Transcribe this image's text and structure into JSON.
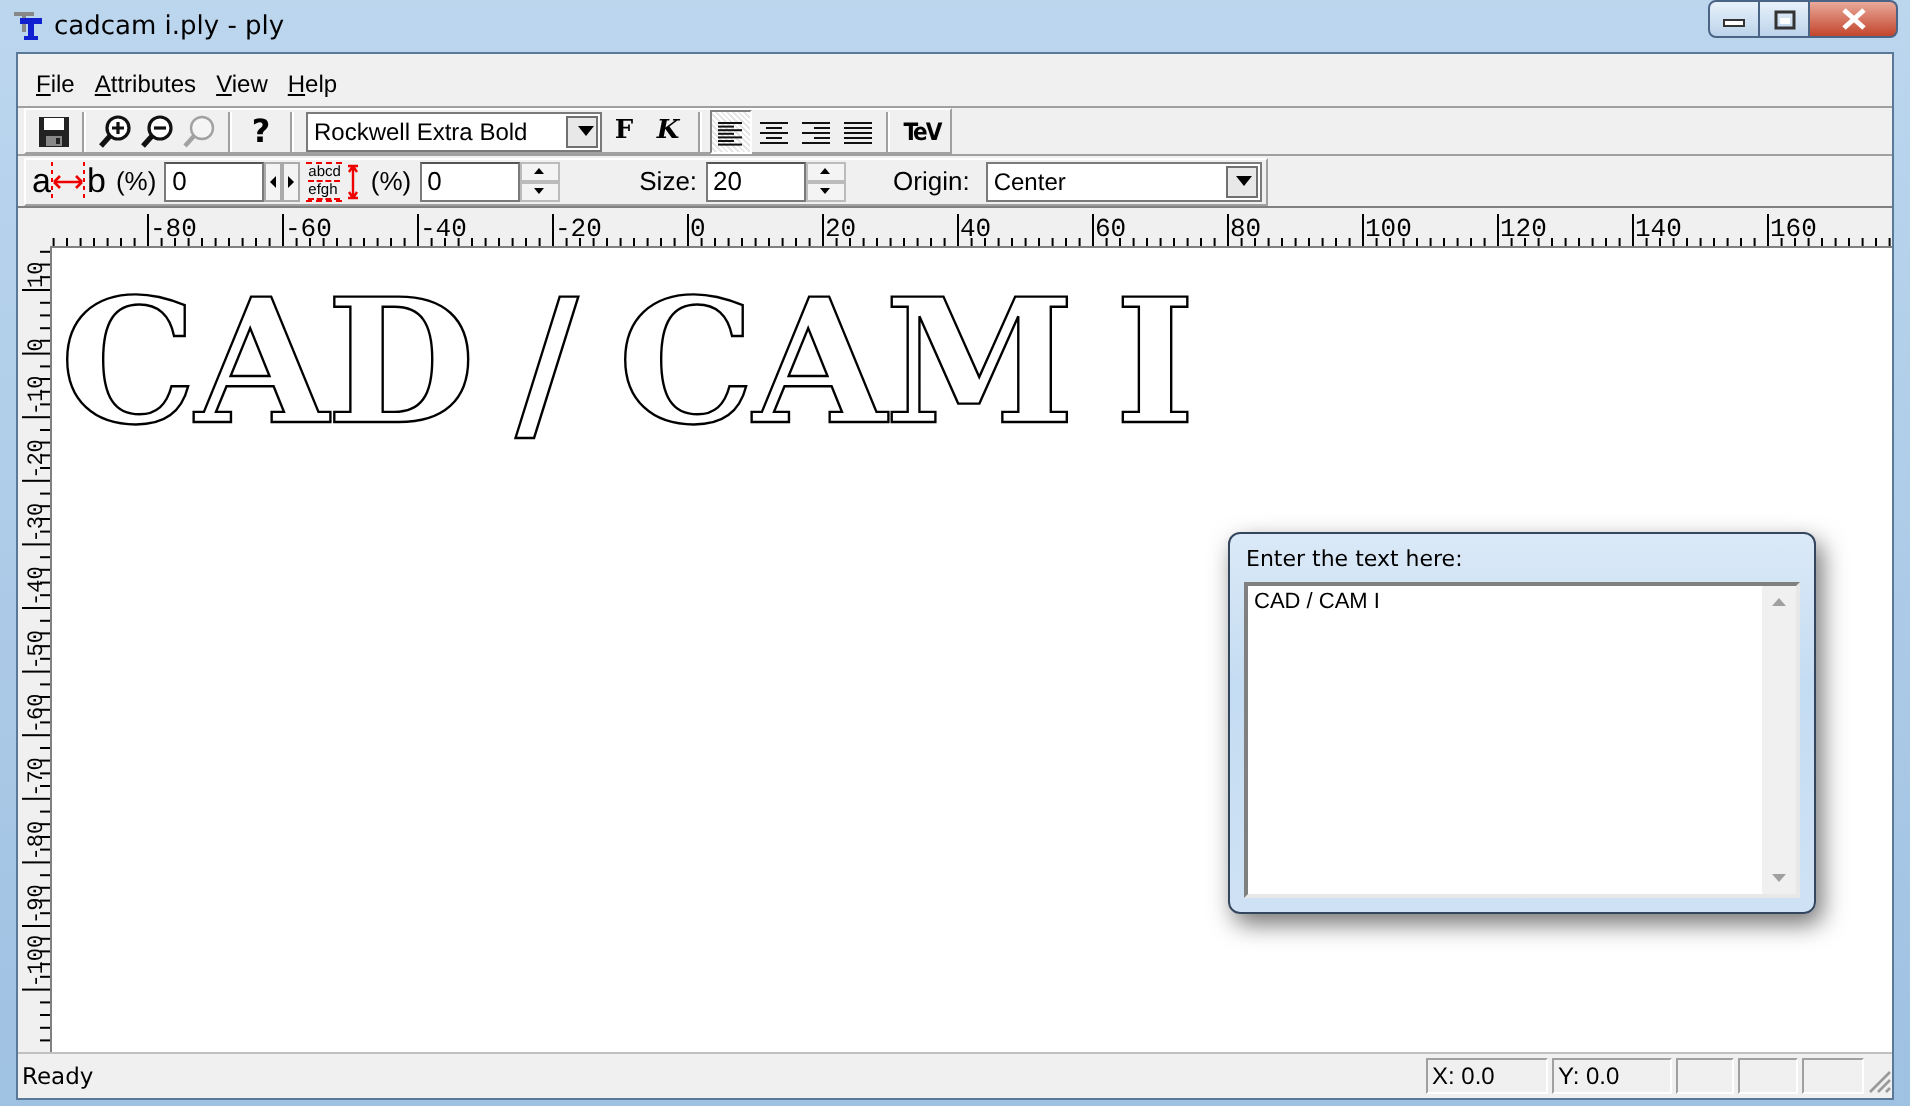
{
  "window": {
    "title": "cadcam i.ply - ply"
  },
  "menu": [
    "File",
    "Attributes",
    "View",
    "Help"
  ],
  "toolbar": {
    "tools": [
      {
        "kind": "save",
        "disabled": false
      },
      {
        "kind": "zoom-in",
        "disabled": false
      },
      {
        "kind": "zoom-out",
        "disabled": false
      },
      {
        "kind": "zoom-fit",
        "disabled": true
      },
      {
        "kind": "help",
        "disabled": false,
        "glyph": "?"
      }
    ],
    "font": "Rockwell Extra Bold",
    "bold_label": "F",
    "italic_label": "K",
    "alignments": [
      {
        "kind": "left",
        "selected": true
      },
      {
        "kind": "center",
        "selected": false
      },
      {
        "kind": "right",
        "selected": false
      },
      {
        "kind": "justify",
        "selected": false
      }
    ],
    "tev_label": "TeV"
  },
  "format_bar": {
    "char_spacing": {
      "icon_letters": [
        "a",
        "b"
      ],
      "unit": "(%)",
      "value": "0"
    },
    "line_spacing": {
      "icon_lines": [
        "abcd",
        "efgh"
      ],
      "unit": "(%)",
      "value": "0"
    },
    "size": {
      "label": "Size:",
      "value": "20"
    },
    "origin": {
      "label": "Origin:",
      "value": "Center"
    }
  },
  "rulers": {
    "horizontal": [
      "-80",
      "-60",
      "-40",
      "-20",
      "0",
      "20",
      "40",
      "60",
      "80",
      "100",
      "120",
      "140",
      "160"
    ],
    "vertical": [
      "10",
      "0",
      "-10",
      "-20",
      "-30",
      "-40",
      "-50",
      "-60",
      "-70",
      "-80",
      "-90",
      "-100"
    ]
  },
  "canvas": {
    "text": "CAD / CAM I"
  },
  "text_dialog": {
    "title": "Enter the text here:",
    "value": "CAD / CAM I"
  },
  "status_bar": {
    "message": "Ready",
    "x": "X: 0.0",
    "y": "Y: 0.0"
  }
}
